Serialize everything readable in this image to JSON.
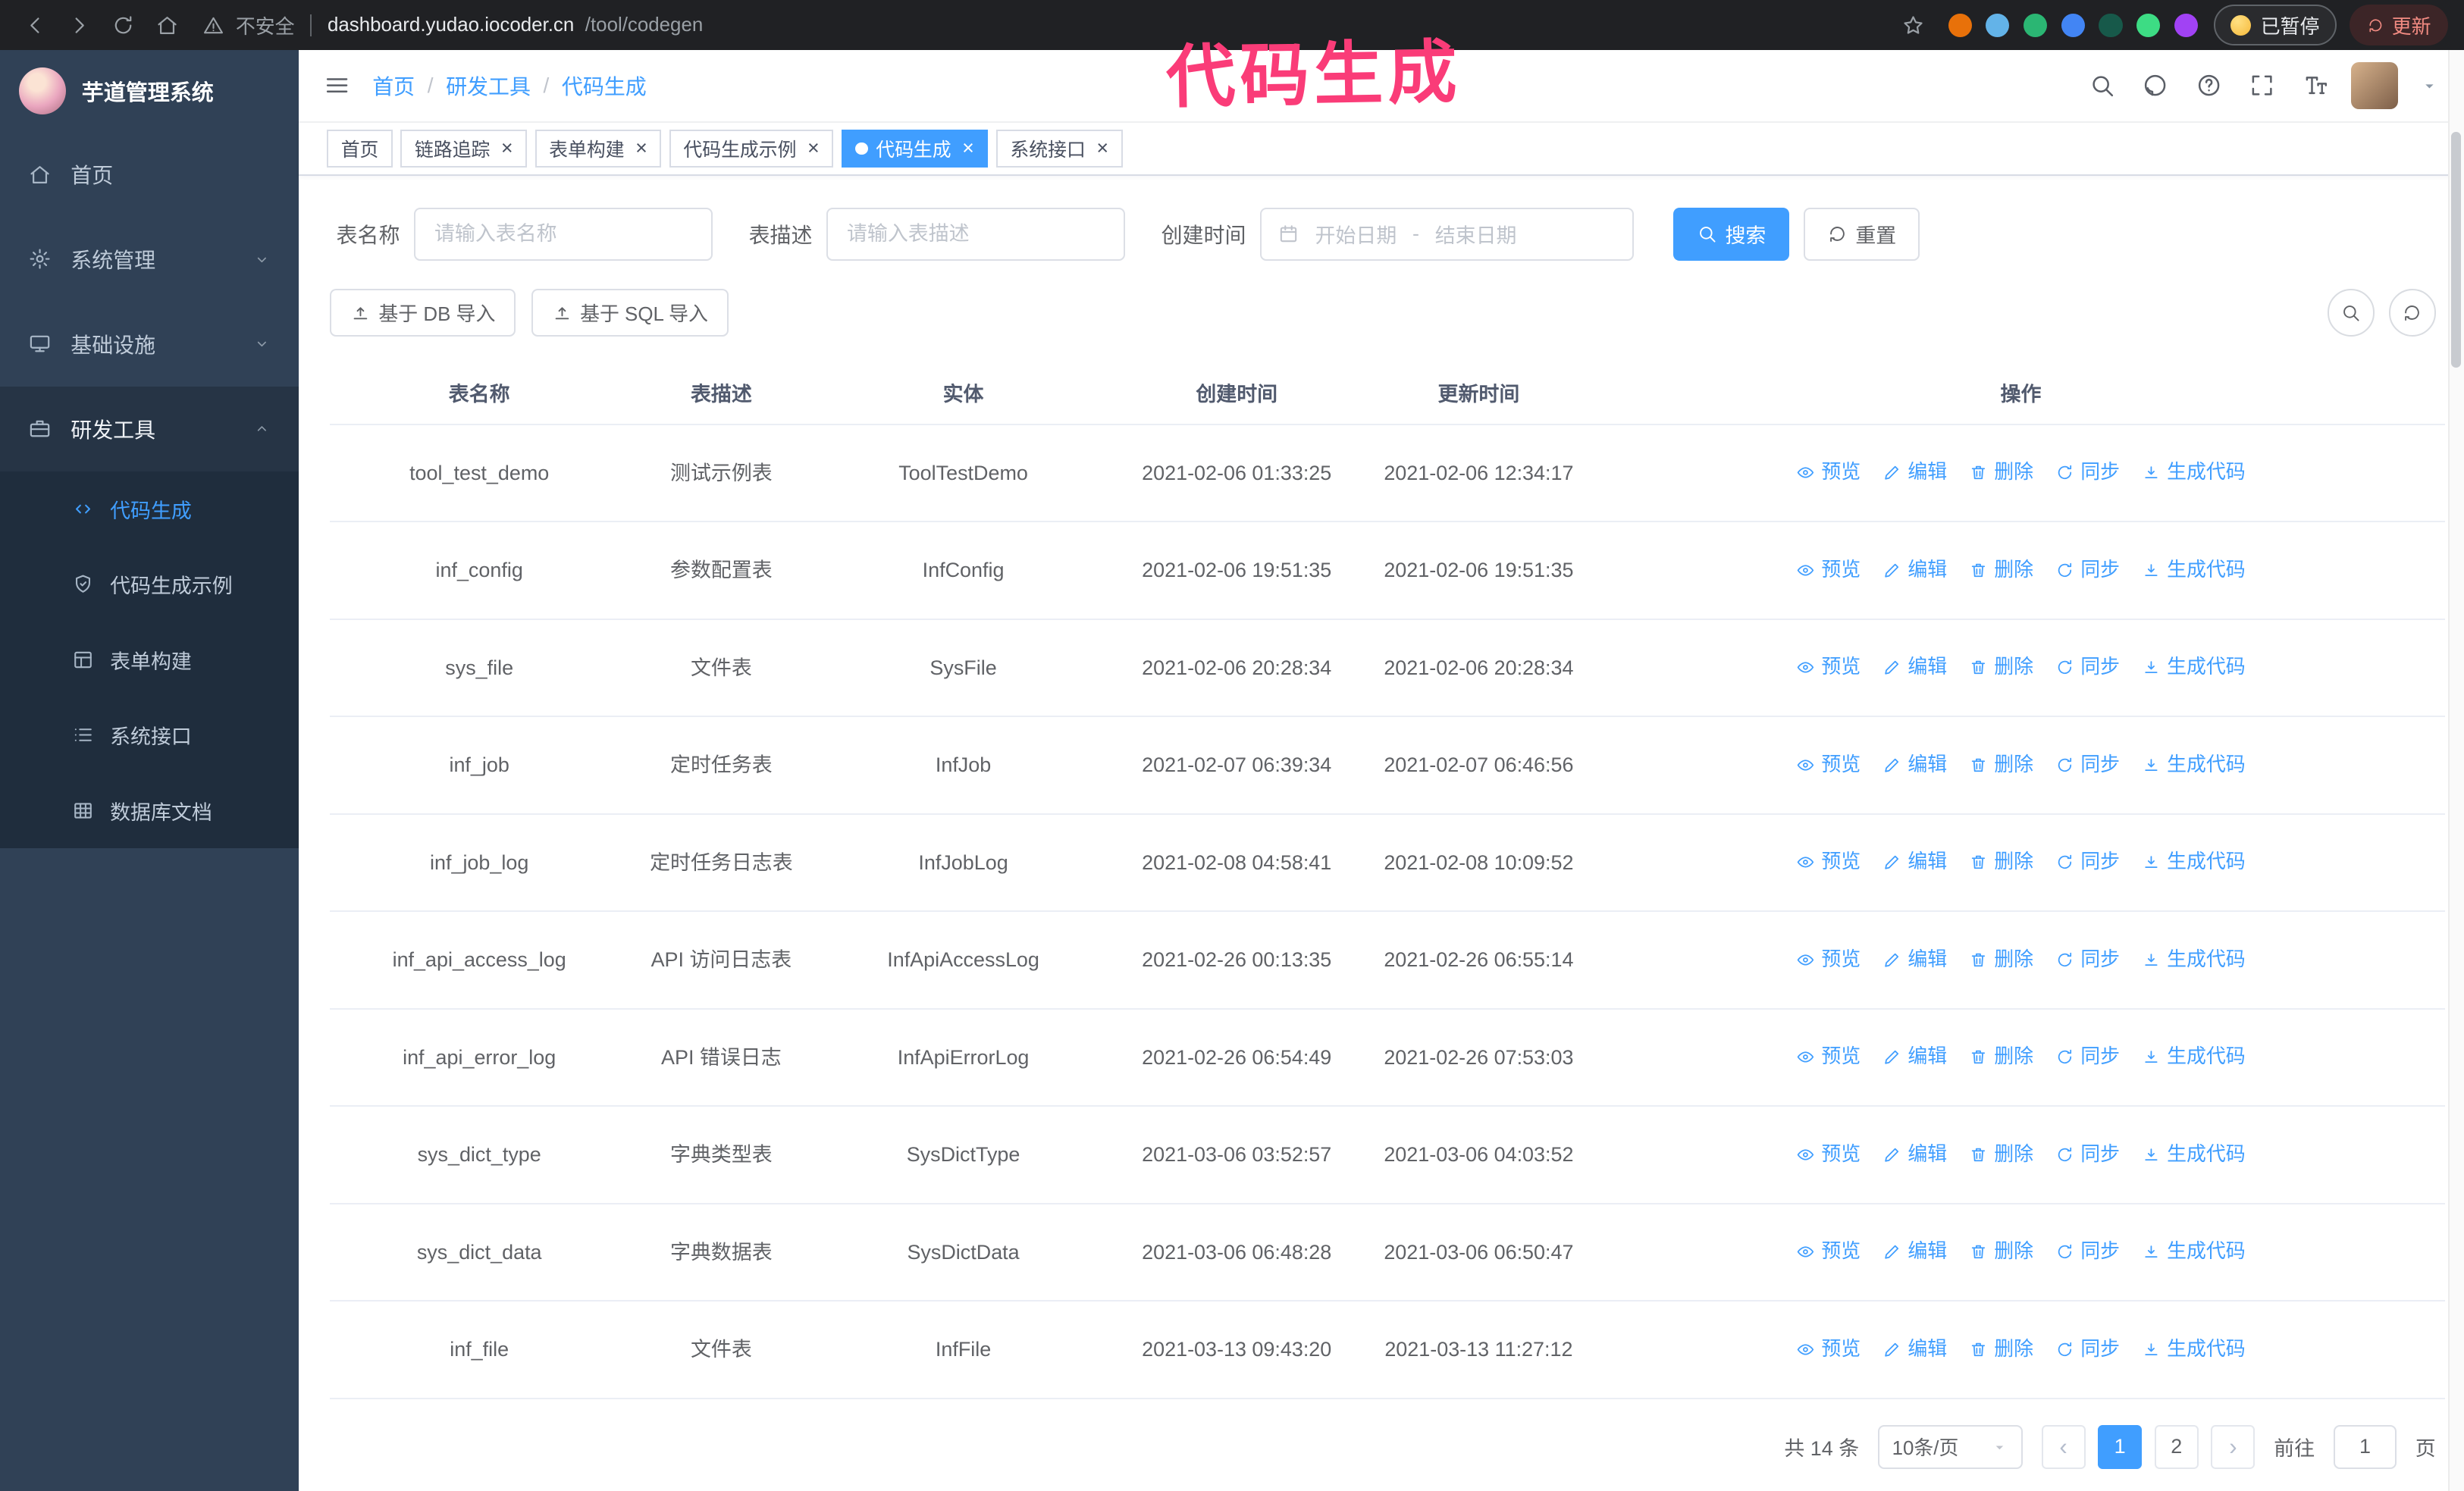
{
  "annotation": {
    "text": "代码生成",
    "color": "#fa3c78"
  },
  "browser": {
    "nav_icons": [
      "back-icon",
      "forward-icon",
      "reload-icon",
      "home-icon"
    ],
    "security_label": "不安全",
    "url_host": "dashboard.yudao.iocoder.cn",
    "url_path": "/tool/codegen",
    "extension_colors": [
      "#e8710a",
      "#63b3e8",
      "#2bb673",
      "#4285f4",
      "#17594a",
      "#3ddc84",
      "#a142f4"
    ],
    "paused_badge": "已暂停",
    "update_button": "更新"
  },
  "sidebar": {
    "logo_title": "芋道管理系统",
    "menu": [
      {
        "label": "首页",
        "icon": "home-icon",
        "type": "item",
        "expanded": false
      },
      {
        "label": "系统管理",
        "icon": "gear-icon",
        "type": "group",
        "expanded": false
      },
      {
        "label": "基础设施",
        "icon": "infra-icon",
        "type": "group",
        "expanded": false
      },
      {
        "label": "研发工具",
        "icon": "tools-icon",
        "type": "group",
        "expanded": true,
        "children": [
          {
            "label": "代码生成",
            "icon": "code-icon",
            "active": true
          },
          {
            "label": "代码生成示例",
            "icon": "example-icon",
            "active": false
          },
          {
            "label": "表单构建",
            "icon": "form-icon",
            "active": false
          },
          {
            "label": "系统接口",
            "icon": "api-icon",
            "active": false
          },
          {
            "label": "数据库文档",
            "icon": "database-icon",
            "active": false
          }
        ]
      }
    ]
  },
  "header": {
    "breadcrumb": [
      "首页",
      "研发工具",
      "代码生成"
    ],
    "separator": "/",
    "icons": [
      "search-icon",
      "github-icon",
      "question-icon",
      "fullscreen-icon",
      "fontsize-icon"
    ]
  },
  "tabs": [
    {
      "label": "首页",
      "closable": false,
      "active": false
    },
    {
      "label": "链路追踪",
      "closable": true,
      "active": false
    },
    {
      "label": "表单构建",
      "closable": true,
      "active": false
    },
    {
      "label": "代码生成示例",
      "closable": true,
      "active": false
    },
    {
      "label": "代码生成",
      "closable": true,
      "active": true
    },
    {
      "label": "系统接口",
      "closable": true,
      "active": false
    }
  ],
  "filters": {
    "table_name_label": "表名称",
    "table_name_placeholder": "请输入表名称",
    "table_desc_label": "表描述",
    "table_desc_placeholder": "请输入表描述",
    "create_time_label": "创建时间",
    "start_date_placeholder": "开始日期",
    "range_separator": "-",
    "end_date_placeholder": "结束日期",
    "search_button": "搜索",
    "reset_button": "重置"
  },
  "toolbar": {
    "import_db": "基于 DB 导入",
    "import_sql": "基于 SQL 导入"
  },
  "table": {
    "columns": [
      "表名称",
      "表描述",
      "实体",
      "创建时间",
      "更新时间",
      "操作"
    ],
    "row_actions": [
      {
        "name": "preview",
        "label": "预览",
        "icon": "eye-icon"
      },
      {
        "name": "edit",
        "label": "编辑",
        "icon": "edit-icon"
      },
      {
        "name": "delete",
        "label": "删除",
        "icon": "delete-icon"
      },
      {
        "name": "sync",
        "label": "同步",
        "icon": "sync-icon"
      },
      {
        "name": "generate",
        "label": "生成代码",
        "icon": "download-icon"
      }
    ],
    "rows": [
      {
        "name": "tool_test_demo",
        "desc": "测试示例表",
        "entity": "ToolTestDemo",
        "created": "2021-02-06 01:33:25",
        "updated": "2021-02-06 12:34:17"
      },
      {
        "name": "inf_config",
        "desc": "参数配置表",
        "entity": "InfConfig",
        "created": "2021-02-06 19:51:35",
        "updated": "2021-02-06 19:51:35"
      },
      {
        "name": "sys_file",
        "desc": "文件表",
        "entity": "SysFile",
        "created": "2021-02-06 20:28:34",
        "updated": "2021-02-06 20:28:34"
      },
      {
        "name": "inf_job",
        "desc": "定时任务表",
        "entity": "InfJob",
        "created": "2021-02-07 06:39:34",
        "updated": "2021-02-07 06:46:56"
      },
      {
        "name": "inf_job_log",
        "desc": "定时任务日志表",
        "entity": "InfJobLog",
        "created": "2021-02-08 04:58:41",
        "updated": "2021-02-08 10:09:52"
      },
      {
        "name": "inf_api_access_log",
        "desc": "API 访问日志表",
        "entity": "InfApiAccessLog",
        "created": "2021-02-26 00:13:35",
        "updated": "2021-02-26 06:55:14"
      },
      {
        "name": "inf_api_error_log",
        "desc": "API 错误日志",
        "entity": "InfApiErrorLog",
        "created": "2021-02-26 06:54:49",
        "updated": "2021-02-26 07:53:03"
      },
      {
        "name": "sys_dict_type",
        "desc": "字典类型表",
        "entity": "SysDictType",
        "created": "2021-03-06 03:52:57",
        "updated": "2021-03-06 04:03:52"
      },
      {
        "name": "sys_dict_data",
        "desc": "字典数据表",
        "entity": "SysDictData",
        "created": "2021-03-06 06:48:28",
        "updated": "2021-03-06 06:50:47"
      },
      {
        "name": "inf_file",
        "desc": "文件表",
        "entity": "InfFile",
        "created": "2021-03-13 09:43:20",
        "updated": "2021-03-13 11:27:12"
      }
    ]
  },
  "pagination": {
    "total_label": "共 14 条",
    "page_size_label": "10条/页",
    "pages": [
      "1",
      "2"
    ],
    "active_page": "1",
    "goto_label": "前往",
    "goto_value": "1",
    "page_unit": "页"
  },
  "colors": {
    "primary": "#409eff",
    "sidebar_bg": "#304156",
    "submenu_bg": "#1f2d3d",
    "annotation": "#fa3c78"
  }
}
